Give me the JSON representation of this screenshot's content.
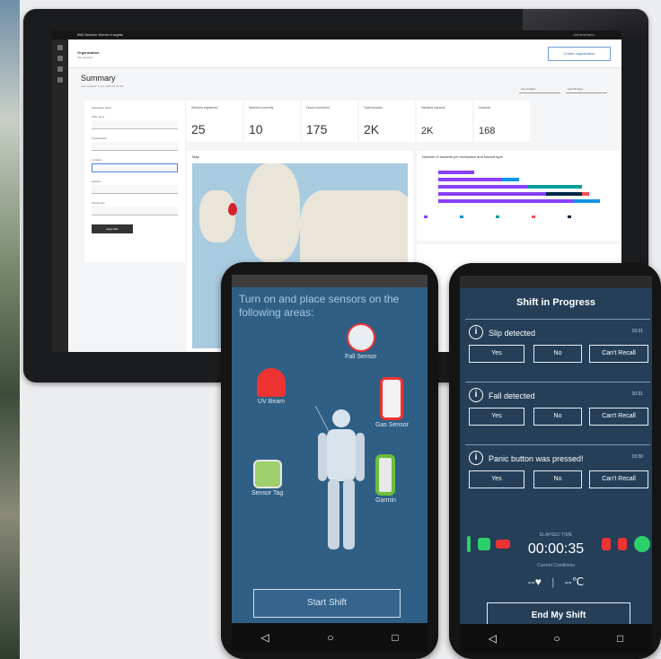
{
  "dashboard": {
    "brand": "IBM Maximo Worker Insights",
    "user": "Administrator",
    "org": "Organization",
    "org_sub": "Site selection",
    "header_button": "Create organization",
    "title": "Summary",
    "subtitle": "Last updated: 5 Jun 2020 10:24 AM",
    "dropdown_left": "Any location",
    "dropdown_right": "Last 30 days",
    "filters": {
      "label_1": "Workplace filters",
      "label_2": "Shift name",
      "label_3": "Organization",
      "label_4": "Location",
      "label_5": "Hazard",
      "label_6": "Shield type",
      "apply": "Apply filter"
    },
    "kpis": [
      {
        "label": "Workers registered",
        "value": "25"
      },
      {
        "label": "Workers currently",
        "value": "10"
      },
      {
        "label": "Hours monitored",
        "value": "175"
      },
      {
        "label": "Total hazards",
        "value": "2K"
      },
      {
        "label": "Handled hazards",
        "value": "2K"
      },
      {
        "label": "Hazards",
        "value": "168"
      }
    ],
    "map_label": "Map",
    "bar_label": "Number of hazards per workplace and hazard type",
    "colors": {
      "bar_purple": "#8a3ffc",
      "bar_blue": "#1192e8",
      "bar_teal": "#009d9a",
      "bar_red": "#fa4d56",
      "bar_navy": "#012749"
    }
  },
  "phone1": {
    "title": "Turn on and place sensors on the following areas:",
    "sensors": [
      {
        "icon": "helmet-icon",
        "label": "UV Beam"
      },
      {
        "icon": "fall-sensor-icon",
        "label": "Fall Sensor"
      },
      {
        "icon": "gas-sensor-icon",
        "label": "Gas Sensor"
      },
      {
        "icon": "sensor-tag-icon",
        "label": "Sensor Tag"
      },
      {
        "icon": "wearable-icon",
        "label": "Garmin"
      }
    ],
    "start_button": "Start Shift",
    "nav": [
      "◁",
      "○",
      "□"
    ]
  },
  "phone2": {
    "title": "Shift in Progress",
    "alerts": [
      {
        "text": "Slip detected",
        "time": "10:31",
        "buttons": [
          "Yes",
          "No",
          "Can't Recall"
        ]
      },
      {
        "text": "Fall detected",
        "time": "10:31",
        "buttons": [
          "Yes",
          "No",
          "Can't Recall"
        ]
      },
      {
        "text": "Panic button was pressed!",
        "time": "10:30",
        "buttons": [
          "Yes",
          "No",
          "Can't Recall"
        ]
      }
    ],
    "elapsed_label": "ELAPSED TIME",
    "timer": "00:00:35",
    "conditions_label": "Current Conditions",
    "heart": "--♥",
    "temp": "--℃",
    "end_button": "End My Shift",
    "nav": [
      "◁",
      "○",
      "□"
    ]
  }
}
